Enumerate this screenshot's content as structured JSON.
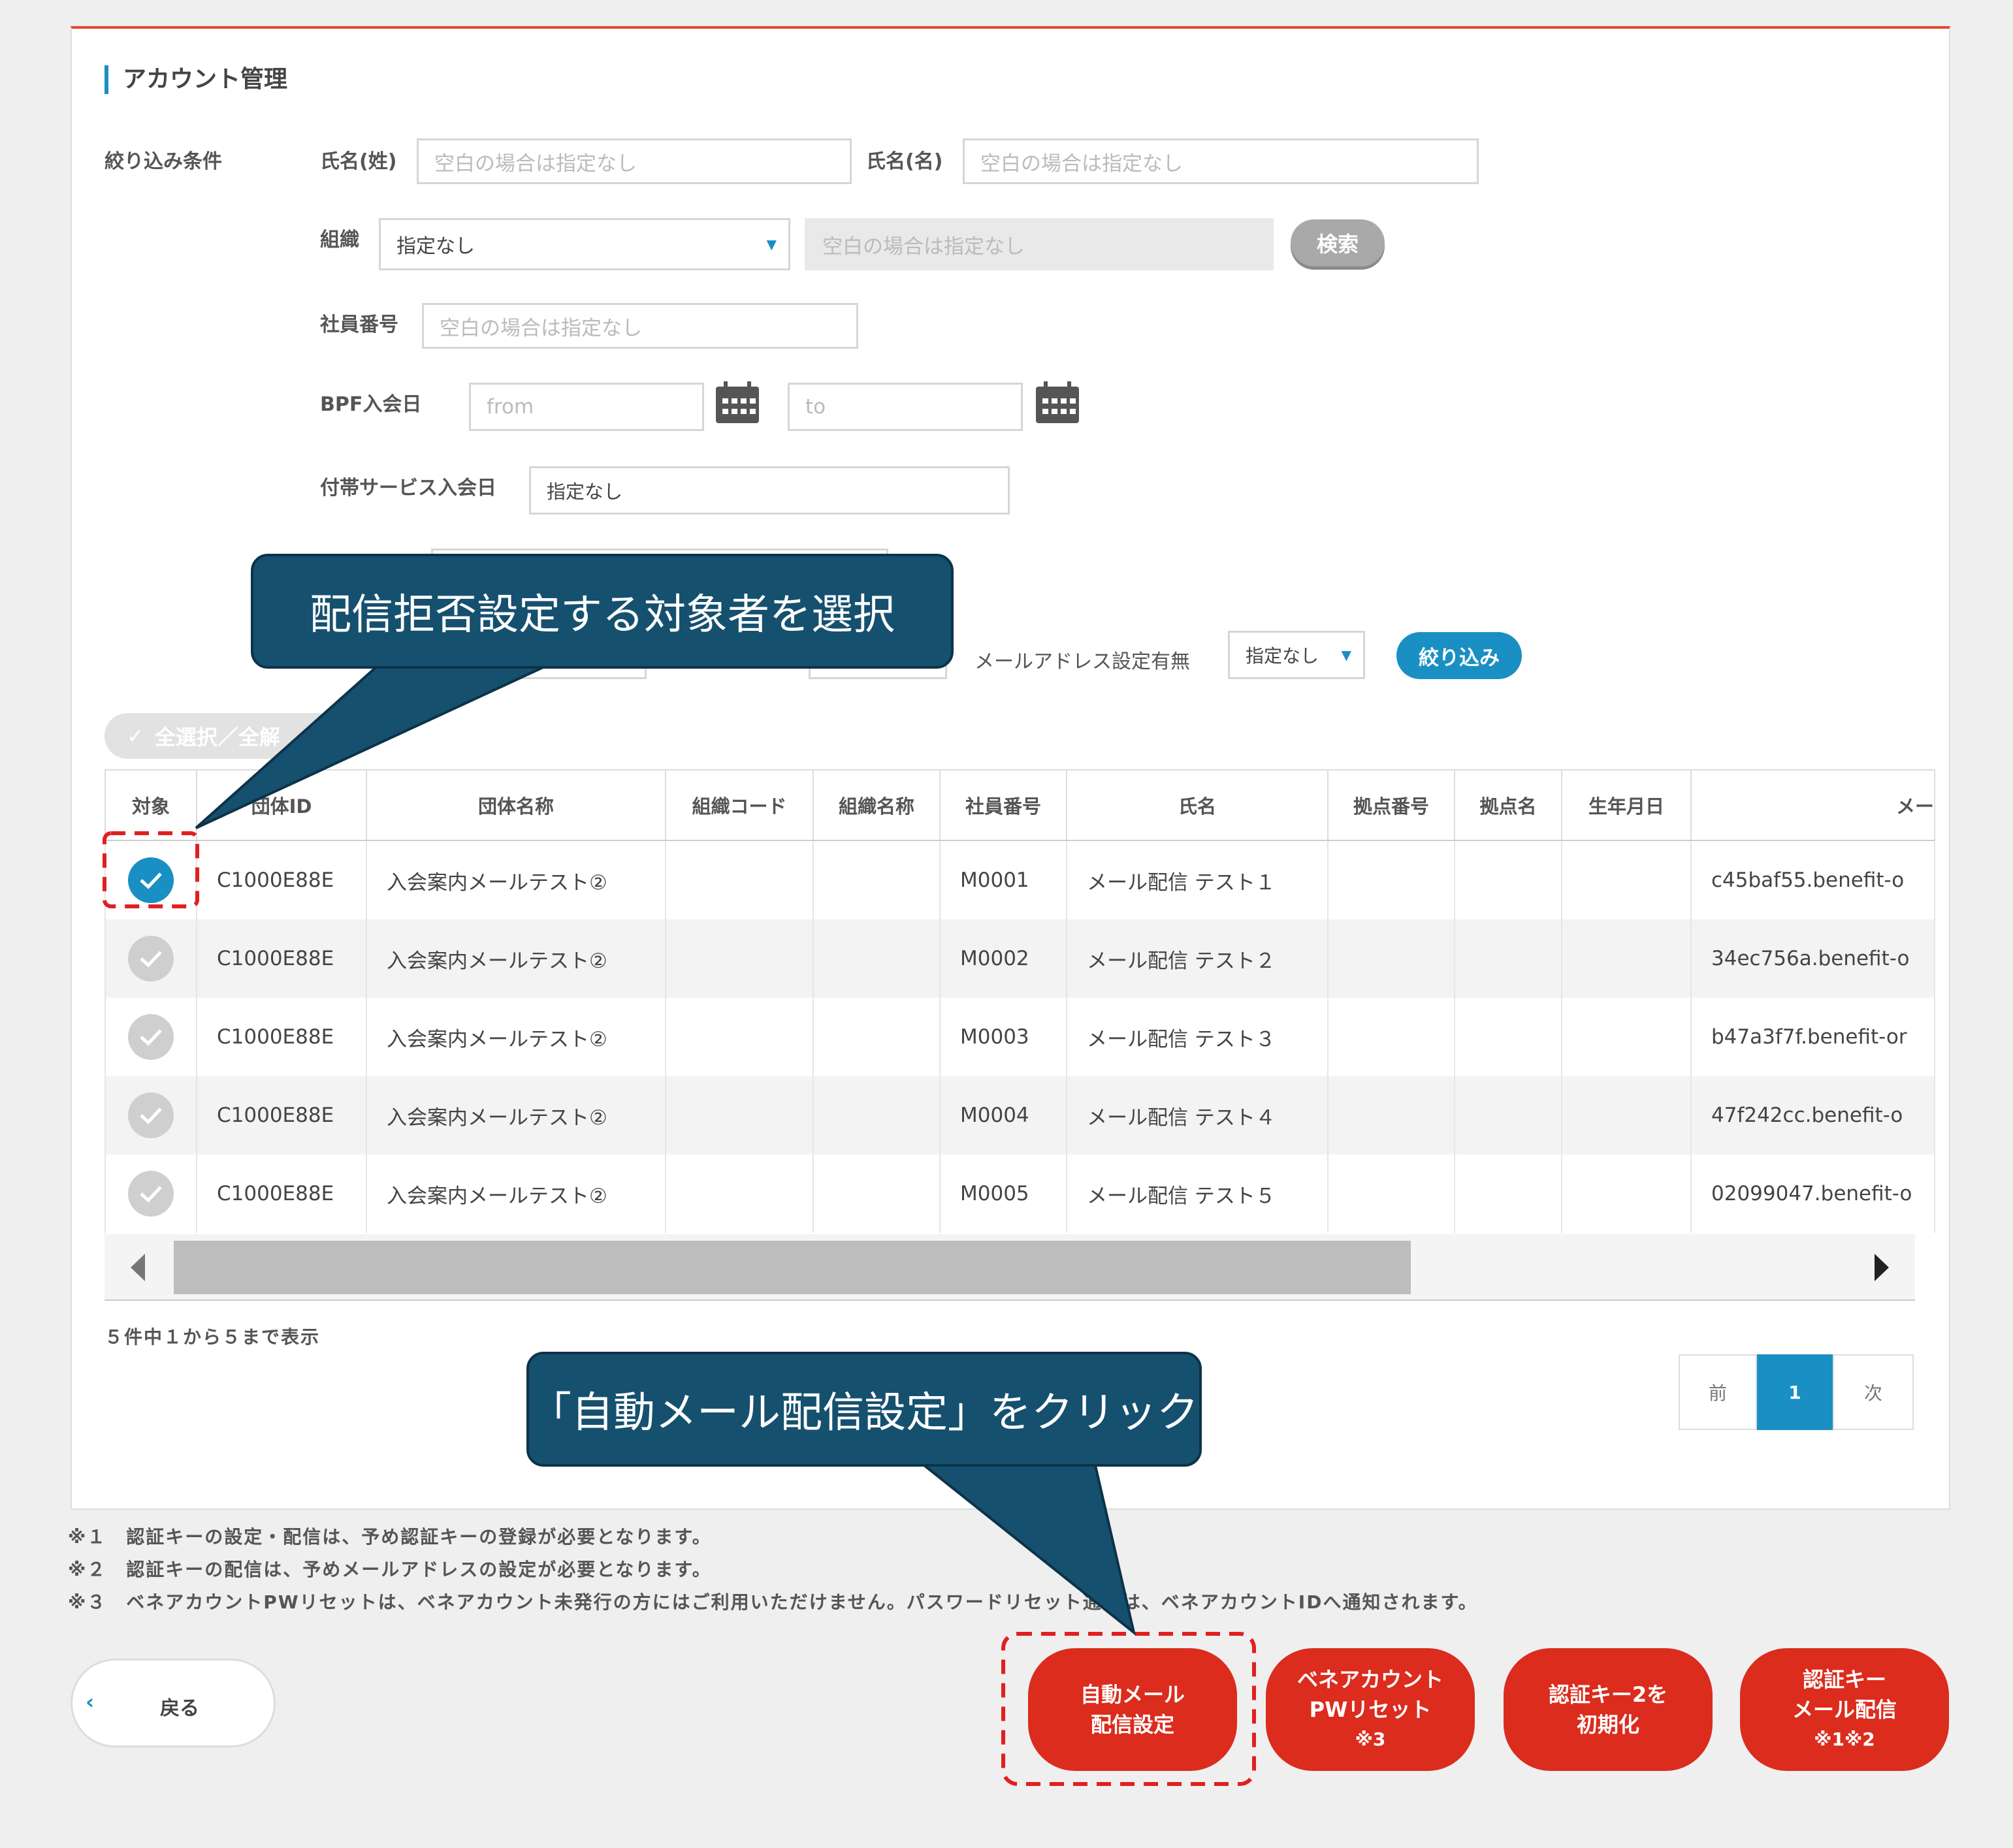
{
  "section_title": "アカウント管理",
  "filters": {
    "heading": "絞り込み条件",
    "last_name_label": "氏名(姓)",
    "first_name_label": "氏名(名)",
    "blank_placeholder": "空白の場合は指定なし",
    "org_label": "組織",
    "org_select_value": "指定なし",
    "search_button": "検索",
    "employee_no_label": "社員番号",
    "bpf_join_label": "BPF入会日",
    "from_placeholder": "from",
    "to_placeholder": "to",
    "addon_join_label": "付帯サービス入会日",
    "addon_value": "指定なし",
    "mail_setting_label": "メールアドレス設定有無",
    "mail_setting_value": "指定なし",
    "filter_button": "絞り込み"
  },
  "select_all_button": "全選択／全解",
  "table": {
    "columns": [
      "対象",
      "団体ID",
      "団体名称",
      "組織コード",
      "組織名称",
      "社員番号",
      "氏名",
      "拠点番号",
      "拠点名",
      "生年月日",
      "メー"
    ],
    "rows": [
      {
        "checked": true,
        "group_id": "C1000E88E",
        "group_name": "入会案内メールテスト②",
        "org_code": "",
        "org_name": "",
        "emp_no": "M0001",
        "name": "メール配信 テスト１",
        "base_no": "",
        "base_name": "",
        "birth": "",
        "email": "c45baf55.benefit-o"
      },
      {
        "checked": false,
        "group_id": "C1000E88E",
        "group_name": "入会案内メールテスト②",
        "org_code": "",
        "org_name": "",
        "emp_no": "M0002",
        "name": "メール配信 テスト２",
        "base_no": "",
        "base_name": "",
        "birth": "",
        "email": "34ec756a.benefit-o"
      },
      {
        "checked": false,
        "group_id": "C1000E88E",
        "group_name": "入会案内メールテスト②",
        "org_code": "",
        "org_name": "",
        "emp_no": "M0003",
        "name": "メール配信 テスト３",
        "base_no": "",
        "base_name": "",
        "birth": "",
        "email": "b47a3f7f.benefit-or"
      },
      {
        "checked": false,
        "group_id": "C1000E88E",
        "group_name": "入会案内メールテスト②",
        "org_code": "",
        "org_name": "",
        "emp_no": "M0004",
        "name": "メール配信 テスト４",
        "base_no": "",
        "base_name": "",
        "birth": "",
        "email": "47f242cc.benefit-o"
      },
      {
        "checked": false,
        "group_id": "C1000E88E",
        "group_name": "入会案内メールテスト②",
        "org_code": "",
        "org_name": "",
        "emp_no": "M0005",
        "name": "メール配信 テスト５",
        "base_no": "",
        "base_name": "",
        "birth": "",
        "email": "02099047.benefit-o"
      }
    ]
  },
  "result_count": "５件中１から５まで表示",
  "pagination": {
    "prev": "前",
    "current": "1",
    "next": "次"
  },
  "notes": [
    "※１　認証キーの設定・配信は、予め認証キーの登録が必要となります。",
    "※２　認証キーの配信は、予めメールアドレスの設定が必要となります。",
    "※３　ベネアカウントPWリセットは、ベネアカウント未発行の方にはご利用いただけません。パスワードリセット通知は、ベネアカウントIDへ通知されます。"
  ],
  "back_button": "戻る",
  "action_buttons": [
    {
      "line1": "自動メール",
      "line2": "配信設定",
      "line3": ""
    },
    {
      "line1": "ベネアカウント",
      "line2": "PWリセット",
      "line3": "※3"
    },
    {
      "line1": "認証キー2を",
      "line2": "初期化",
      "line3": ""
    },
    {
      "line1": "認証キー",
      "line2": "メール配信",
      "line3": "※1※2"
    }
  ],
  "callouts": {
    "select_target": "配信拒否設定する対象者を選択",
    "click_auto_mail": "「自動メール配信設定」をクリック"
  },
  "colors": {
    "accent": "#1a8fc4",
    "danger": "#db2c1e",
    "callout": "#16506f",
    "panel_top": "#e04a32"
  }
}
